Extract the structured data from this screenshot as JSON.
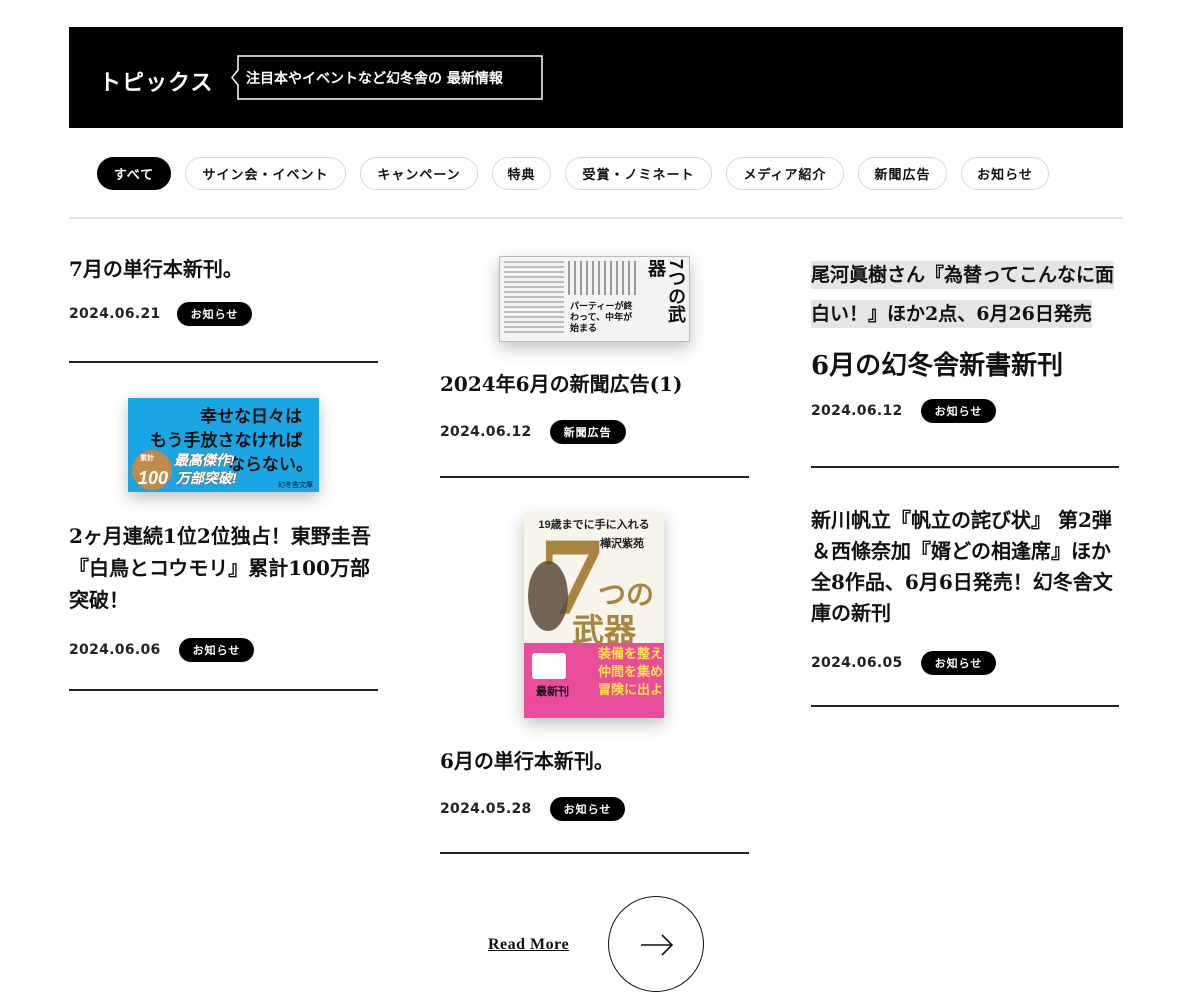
{
  "header": {
    "title": "トピックス",
    "tagline": "注目本やイベントなど幻冬舎の 最新情報"
  },
  "filters": [
    {
      "label": "すべて",
      "active": true
    },
    {
      "label": "サイン会・イベント",
      "active": false
    },
    {
      "label": "キャンペーン",
      "active": false
    },
    {
      "label": "特典",
      "active": false
    },
    {
      "label": "受賞・ノミネート",
      "active": false
    },
    {
      "label": "メディア紹介",
      "active": false
    },
    {
      "label": "新聞広告",
      "active": false
    },
    {
      "label": "お知らせ",
      "active": false
    }
  ],
  "articles": [
    {
      "title": "7月の単行本新刊。",
      "date": "2024.06.21",
      "category": "お知らせ"
    },
    {
      "title": "2ヶ月連続1位2位独占！東野圭吾『白鳥とコウモリ』累計100万部突破！",
      "date": "2024.06.06",
      "category": "お知らせ",
      "image": {
        "line1": "幸せな日々は",
        "line2": "もう手放さなければ",
        "line3": "ならない。",
        "badge_top": "最高傑作!",
        "badge_num": "100",
        "badge_unit": "万部突破!",
        "publisher": "幻冬舎文庫",
        "badge_small": "累計"
      }
    },
    {
      "title": "2024年6月の新聞広告(1)",
      "date": "2024.06.12",
      "category": "新聞広告",
      "image": {
        "big": "7つの武器",
        "sub": "パーティーが終わって、中年が始まる"
      }
    },
    {
      "title": "6月の単行本新刊。",
      "date": "2024.05.28",
      "category": "お知らせ",
      "image": {
        "top": "19歳までに手に入れる",
        "author": "樺沢紫苑",
        "big1": "7",
        "big2": "つの",
        "big3": "武器",
        "pink1": "装備を整え、",
        "pink2": "仲間を集め、",
        "pink3": "冒険に出よう!",
        "side": "最新刊"
      }
    },
    {
      "title": "尾河眞樹さん『為替ってこんなに面白い！』ほか2点、6月26日発売",
      "subtitle": "6月の幻冬舎新書新刊",
      "date": "2024.06.12",
      "category": "お知らせ"
    },
    {
      "title": "新川帆立『帆立の詫び状』 第2弾＆西條奈加『婿どの相逢席』ほか全8作品、6月6日発売！幻冬舎文庫の新刊",
      "date": "2024.06.05",
      "category": "お知らせ"
    }
  ],
  "read_more": "Read More",
  "colors": {
    "accent": "#000000",
    "ad_blue": "#1aa6e4",
    "book_pink": "#e94c9a",
    "book_gold": "#a8843e"
  }
}
